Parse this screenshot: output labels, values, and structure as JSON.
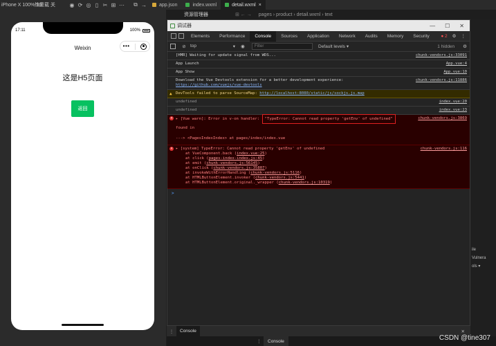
{
  "topbar": {
    "device": "iPhone X 100% 16",
    "network": "热重载 关",
    "tabs": [
      {
        "label": "app.json",
        "active": false
      },
      {
        "label": "index.wxml",
        "active": false
      },
      {
        "label": "detail.wxml",
        "active": true
      }
    ]
  },
  "editor": {
    "explorer": "资源管理器",
    "breadcrumb": "pages › product › detail.wxml › text"
  },
  "phone": {
    "time": "17:11",
    "battery": "100%",
    "nav_title": "Weixin",
    "page_text": "这是H5页面",
    "back_label": "返回"
  },
  "devtools": {
    "title": "调试器",
    "tabs": [
      "Elements",
      "Performance",
      "Console",
      "Sources",
      "Application",
      "Network",
      "Audits",
      "Memory",
      "Security"
    ],
    "active_tab": "Console",
    "error_count": "2",
    "context": "top",
    "filter_placeholder": "Filter",
    "levels": "Default levels",
    "hidden": "1 hidden"
  },
  "console": {
    "rows": [
      {
        "text": "[HMR] Waiting for update signal from WDS...",
        "src": "chunk-vendors.js:33091"
      },
      {
        "text": "App Launch",
        "src": "App.vue:4"
      },
      {
        "text": "App Show",
        "src": "App.vue:10"
      },
      {
        "text": "Download the Vue Devtools extension for a better development experience:",
        "link": "https://github.com/vuejs/vue-devtools",
        "src": "chunk-vendors.js:11886"
      }
    ],
    "warning": {
      "text": "DevTools failed to parse SourceMap: ",
      "link": "http://localhost:8080/static/js/sockjs.js.map"
    },
    "undefined_rows": [
      {
        "text": "undefined",
        "src": "index.vue:20"
      },
      {
        "text": "undefined",
        "src": "index.vue:23"
      }
    ],
    "vue_warn": {
      "prefix": "▸ [Vue warn]: Error in v-on handler: ",
      "highlight": "\"TypeError: Cannot read property 'getEnv' of undefined\"",
      "cont": "found in",
      "trace": "---> <PagesIndexIndex> at pages/index/index.vue",
      "src": "chunk-vendors.js:3869"
    },
    "system_error": {
      "head": "▸ [system] TypeError: Cannot read property 'getEnv' of undefined",
      "src": "chunk-vendors.js:116",
      "trace": [
        {
          "pre": "at VueComponent.back (",
          "link": "index.vue:25",
          "post": ")"
        },
        {
          "pre": "at click (",
          "link": "pages-index-index.js:45",
          "post": ")"
        },
        {
          "pre": "at emit (",
          "link": "chunk-vendors.js:56145",
          "post": ")"
        },
        {
          "pre": "at onClick (",
          "link": "chunk-vendors.js:35807",
          "post": ")"
        },
        {
          "pre": "at invokeWithErrorHandling (",
          "link": "chunk-vendors.js:5116",
          "post": ")"
        },
        {
          "pre": "at HTMLButtonElement.invoker (",
          "link": "chunk-vendors.js:5441",
          "post": ")"
        },
        {
          "pre": "at HTMLButtonElement.original._wrapper (",
          "link": "chunk-vendors.js:10319",
          "post": ")"
        }
      ]
    },
    "prompt": ">"
  },
  "bottom": {
    "console_tab": "Console",
    "console_tab2": "Console"
  },
  "side_right": [
    "ile",
    "Vulnera",
    "ols ▾"
  ],
  "watermark": "CSDN @tine307",
  "colors": {
    "wechat_green": "#07c160",
    "error_bg": "#290000",
    "warn_bg": "#332b00",
    "highlight_border": "#e02020"
  }
}
